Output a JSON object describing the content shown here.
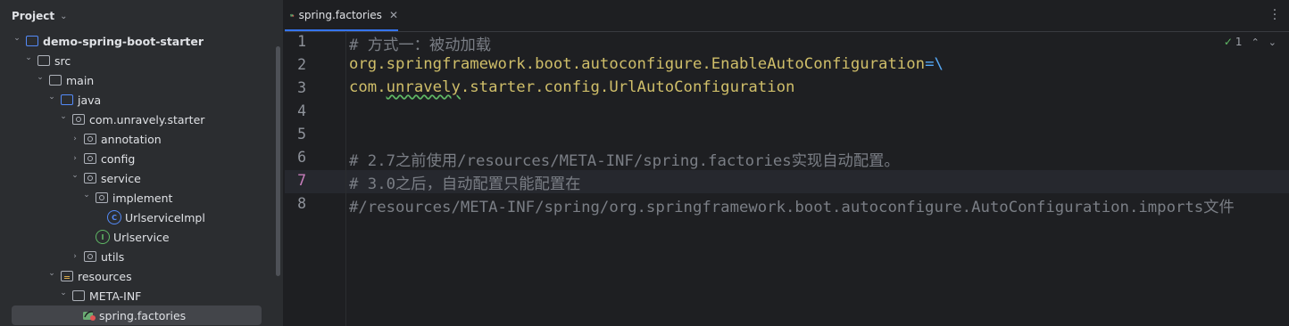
{
  "project_panel": {
    "title": "Project",
    "tree": [
      {
        "label": "demo-spring-boot-starter",
        "icon": "module-folder-icon",
        "level": 0,
        "expanded": true,
        "bold": true
      },
      {
        "label": "src",
        "icon": "folder-icon",
        "level": 1,
        "expanded": true
      },
      {
        "label": "main",
        "icon": "folder-icon",
        "level": 2,
        "expanded": true
      },
      {
        "label": "java",
        "icon": "source-folder-icon",
        "level": 3,
        "expanded": true
      },
      {
        "label": "com.unravely.starter",
        "icon": "package-icon",
        "level": 4,
        "expanded": true
      },
      {
        "label": "annotation",
        "icon": "package-icon",
        "level": 5,
        "expanded": false
      },
      {
        "label": "config",
        "icon": "package-icon",
        "level": 5,
        "expanded": false
      },
      {
        "label": "service",
        "icon": "package-icon",
        "level": 5,
        "expanded": true
      },
      {
        "label": "implement",
        "icon": "package-icon",
        "level": 6,
        "expanded": true
      },
      {
        "label": "UrlserviceImpl",
        "icon": "class-icon",
        "level": 7,
        "leaf": true
      },
      {
        "label": "Urlservice",
        "icon": "interface-icon",
        "level": 6,
        "leaf": true
      },
      {
        "label": "utils",
        "icon": "package-icon",
        "level": 5,
        "expanded": false
      },
      {
        "label": "resources",
        "icon": "resources-folder-icon",
        "level": 3,
        "expanded": true
      },
      {
        "label": "META-INF",
        "icon": "folder-icon",
        "level": 4,
        "expanded": true
      },
      {
        "label": "spring.factories",
        "icon": "spring-file-icon",
        "level": 5,
        "leaf": true,
        "selected": true
      }
    ]
  },
  "editor": {
    "tab": {
      "label": "spring.factories",
      "icon": "spring-file-icon"
    },
    "inspection": {
      "count": "1"
    },
    "current_line": 7,
    "lines": [
      {
        "num": "1",
        "segments": [
          {
            "t": "# 方式一：被动加载",
            "c": "cmt"
          }
        ]
      },
      {
        "num": "2",
        "segments": [
          {
            "t": "org.springframework.boot.autoconfigure.EnableAutoConfiguration",
            "c": "key"
          },
          {
            "t": "=\\",
            "c": "eqs"
          }
        ]
      },
      {
        "num": "3",
        "segments": [
          {
            "t": "com.",
            "c": "key"
          },
          {
            "t": "unravely",
            "c": "key typo"
          },
          {
            "t": ".starter.config.UrlAutoConfiguration",
            "c": "key"
          }
        ]
      },
      {
        "num": "4",
        "segments": []
      },
      {
        "num": "5",
        "segments": []
      },
      {
        "num": "6",
        "segments": [
          {
            "t": "# 2.7之前使用/resources/META-INF/spring.factories实现自动配置。",
            "c": "cmt"
          }
        ]
      },
      {
        "num": "7",
        "segments": [
          {
            "t": "# 3.0之后，自动配置只能配置在",
            "c": "cmt"
          }
        ]
      },
      {
        "num": "8",
        "segments": [
          {
            "t": "#/resources/META-INF/spring/org.springframework.boot.autoconfigure.AutoConfiguration.imports文件",
            "c": "cmt"
          }
        ]
      }
    ]
  },
  "colors": {
    "accent": "#3574f0",
    "comment": "#7a7e85",
    "property": "#cfbe69",
    "operator": "#56a8f5"
  }
}
